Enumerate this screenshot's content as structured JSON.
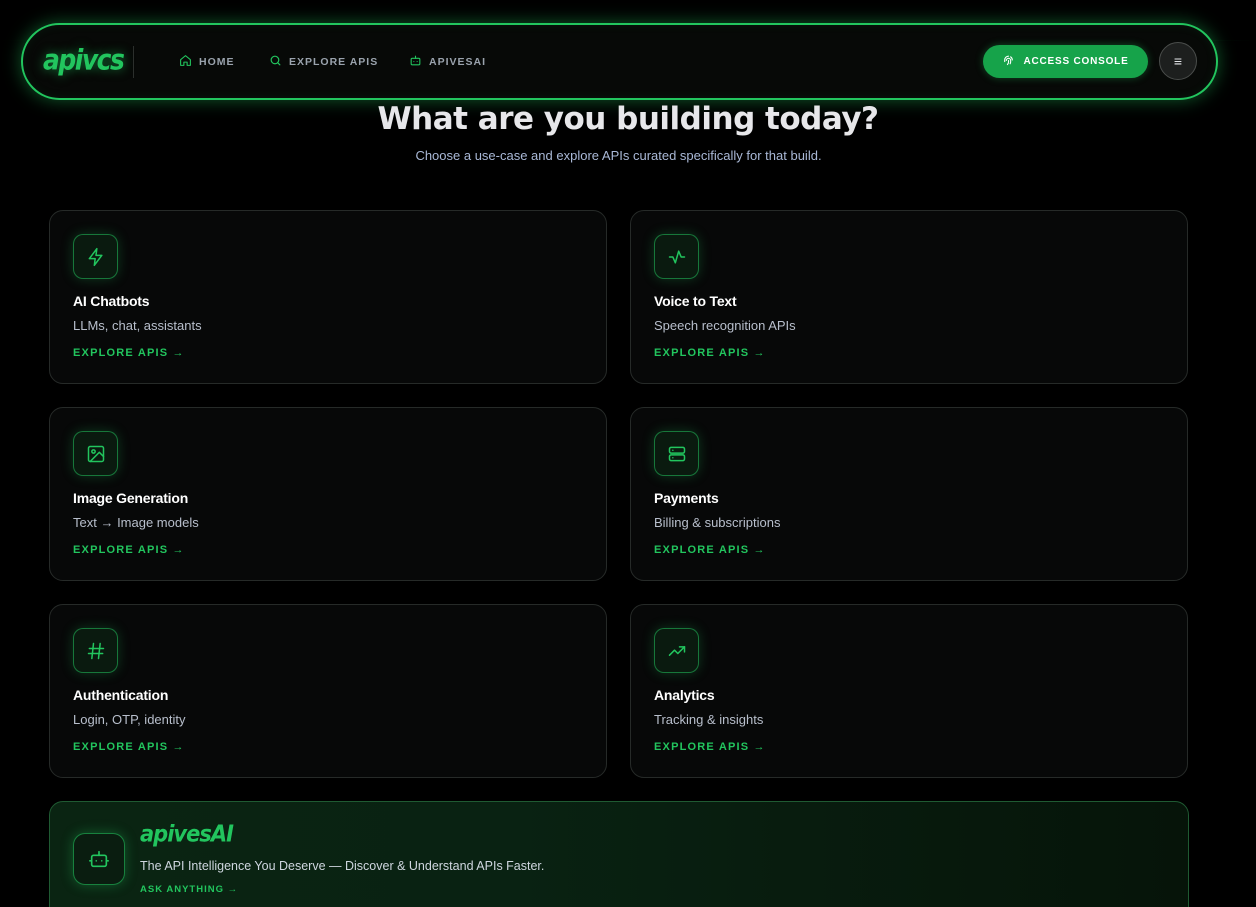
{
  "nav": {
    "logo": "apivcs",
    "links": [
      {
        "label": "HOME",
        "icon": "home-icon"
      },
      {
        "label": "EXPLORE APIS",
        "icon": "search-icon"
      },
      {
        "label": "APIVESAI",
        "icon": "robot-icon"
      }
    ],
    "console_label": "ACCESS CONSOLE",
    "console_icon": "fingerprint-icon",
    "menu_icon": "≡"
  },
  "hero": {
    "title": "What are you building today?",
    "subtitle": "Choose a use-case and explore APIs curated specifically for that build."
  },
  "cards": [
    {
      "title": "AI Chatbots",
      "desc": "LLMs, chat, assistants",
      "link": "EXPLORE APIS →",
      "icon": "lightning-icon"
    },
    {
      "title": "Voice to Text",
      "desc": "Speech recognition APIs",
      "link": "EXPLORE APIS →",
      "icon": "activity-icon"
    },
    {
      "title": "Image Generation",
      "desc": "Text → Image models",
      "link": "EXPLORE APIS →",
      "icon": "image-icon"
    },
    {
      "title": "Payments",
      "desc": "Billing & subscriptions",
      "link": "EXPLORE APIS →",
      "icon": "server-icon"
    },
    {
      "title": "Authentication",
      "desc": "Login, OTP, identity",
      "link": "EXPLORE APIS →",
      "icon": "hash-icon"
    },
    {
      "title": "Analytics",
      "desc": "Tracking & insights",
      "link": "EXPLORE APIS →",
      "icon": "trending-up-icon"
    }
  ],
  "promo": {
    "brand": "apivesAI",
    "text": "The API Intelligence You Deserve — Discover & Understand APIs Faster.",
    "link": "ASK ANYTHING →",
    "icon": "robot-icon"
  },
  "colors": {
    "accent": "#22c55e",
    "button": "#16a34a",
    "background": "#000000",
    "card": "#070808"
  }
}
